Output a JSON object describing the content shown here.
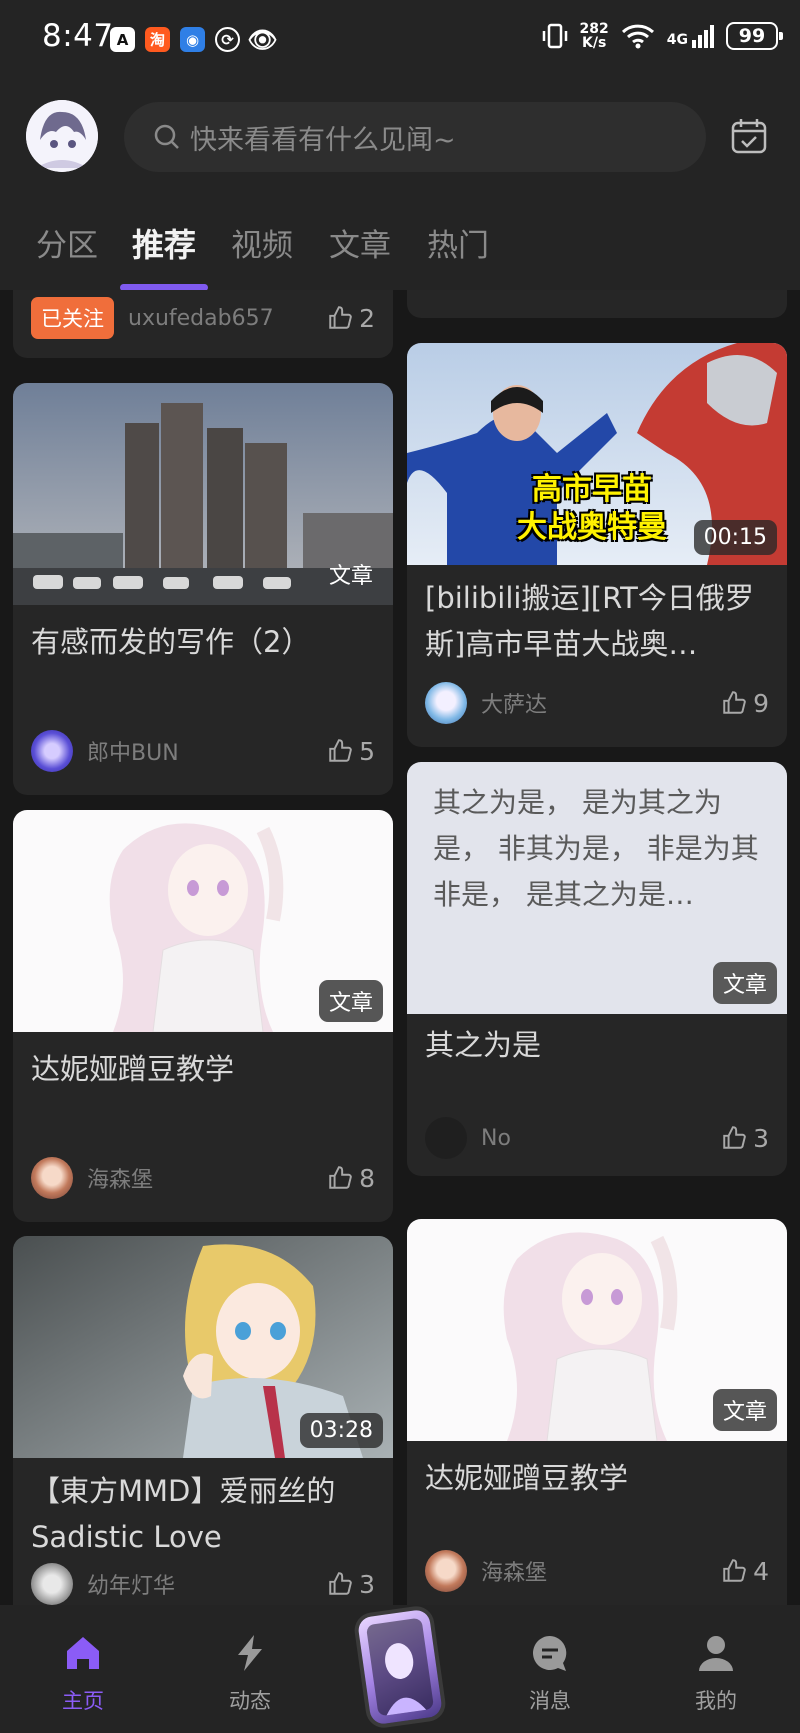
{
  "status_bar": {
    "time": "8:47",
    "net_speed_value": "282",
    "net_speed_unit": "K/s",
    "network": "4G",
    "battery": "99"
  },
  "header": {
    "search_placeholder": "快来看看有什么见闻~",
    "tabs": [
      "分区",
      "推荐",
      "视频",
      "文章",
      "热门"
    ],
    "active_tab": "推荐"
  },
  "feed": {
    "left": [
      {
        "followed_label": "已关注",
        "author": "uxufedab657",
        "likes": "2"
      },
      {
        "tag": "文章",
        "title": "有感而发的写作（2）",
        "author": "郎中BUN",
        "likes": "5"
      },
      {
        "tag": "文章",
        "title": "达妮娅蹭豆教学",
        "author": "海森堡",
        "likes": "8"
      },
      {
        "tag": "03:28",
        "title": "【東方MMD】爱丽丝的Sadistic Love",
        "author": "幼年灯华",
        "likes": "3"
      }
    ],
    "right": [
      {
        "thumb_text": "高市早苗\n大战奥特曼",
        "tag": "00:15",
        "title": "[bilibili搬运][RT今日俄罗斯]高市早苗大战奥…",
        "author": "大萨达",
        "likes": "9"
      },
      {
        "thumb_text": "其之为是， 是为其之为是， 非其为是， 非是为其非是， 是其之为是…",
        "tag": "文章",
        "title": "其之为是",
        "author": "No",
        "likes": "3"
      },
      {
        "tag": "文章",
        "title": "达妮娅蹭豆教学",
        "author": "海森堡",
        "likes": "4"
      }
    ]
  },
  "bottom_nav": {
    "items": [
      "主页",
      "动态",
      "消息",
      "我的"
    ],
    "active": "主页"
  },
  "colors": {
    "accent": "#7f5af0",
    "followed": "#f06e3b",
    "background": "#181818",
    "card": "#262626"
  }
}
